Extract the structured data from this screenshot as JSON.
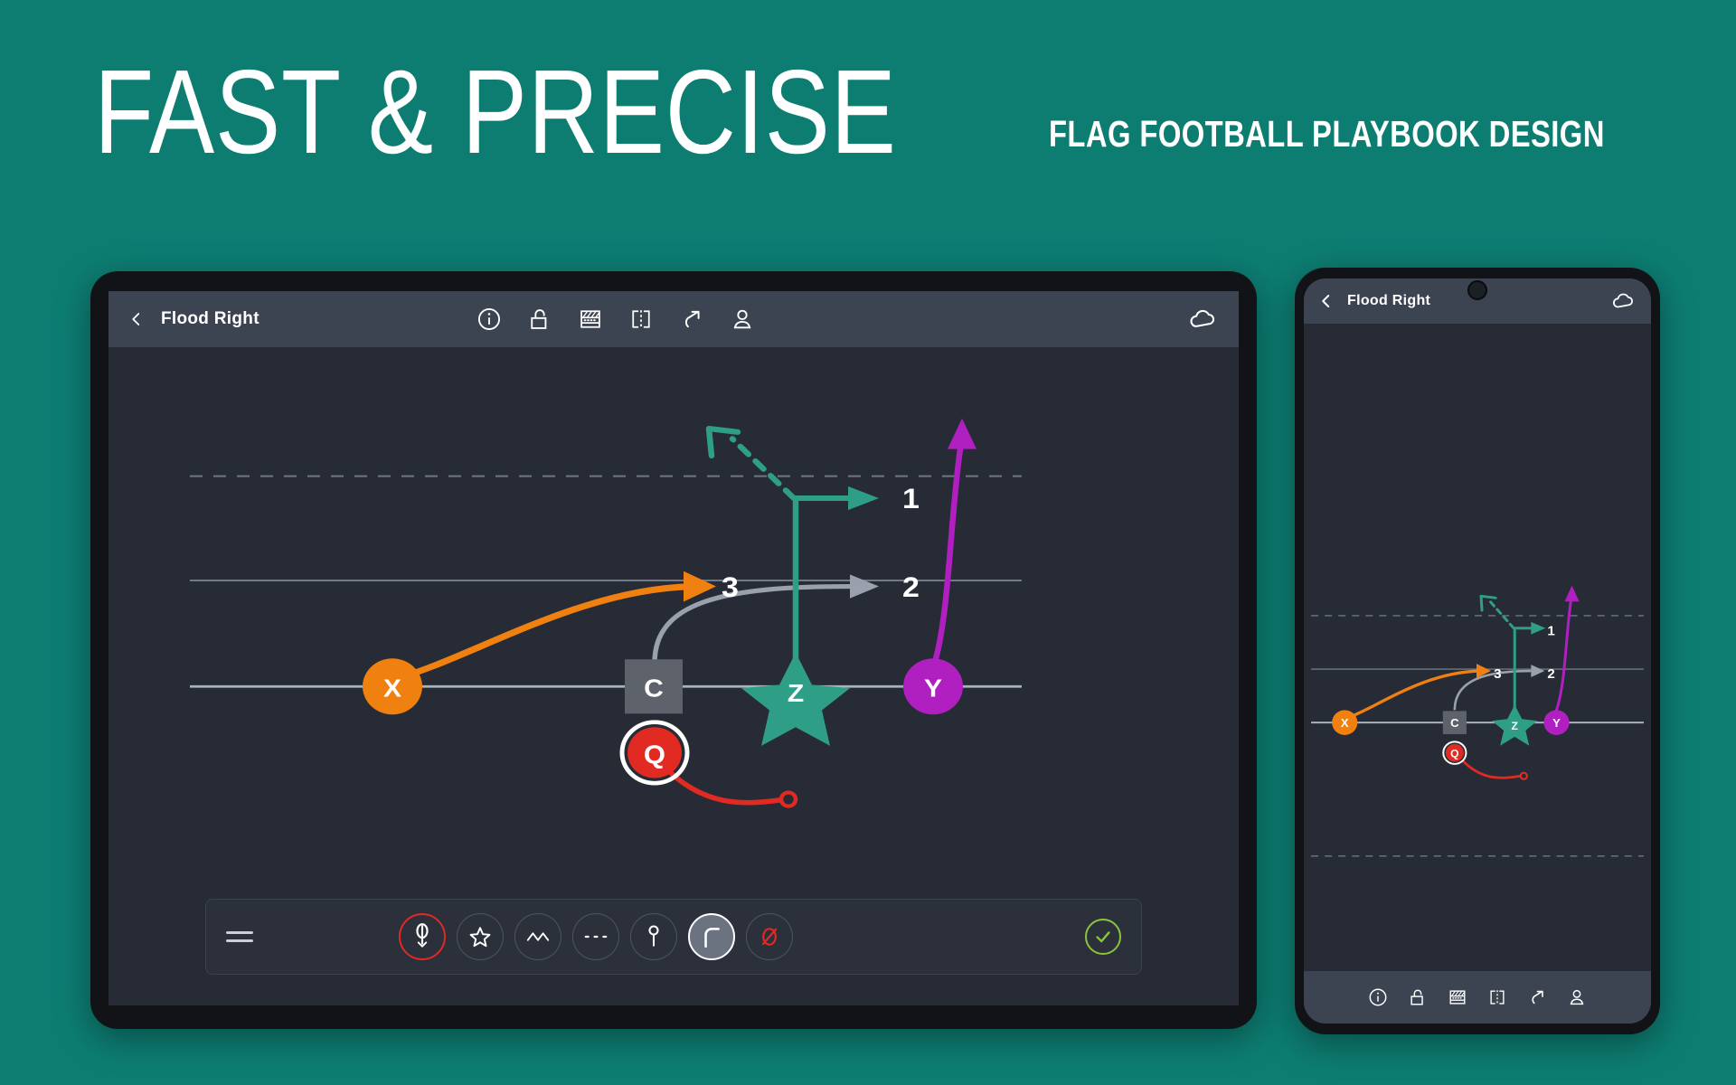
{
  "promo": {
    "headline": "FAST & PRECISE",
    "subhead": "FLAG FOOTBALL PLAYBOOK DESIGN",
    "background_color": "#0d7d72",
    "text_color": "#ffffff"
  },
  "app": {
    "title": "Flood Right",
    "header": {
      "back_label": "Back",
      "tools": [
        {
          "name": "info-icon",
          "label": "Info"
        },
        {
          "name": "unlock-icon",
          "label": "Unlock"
        },
        {
          "name": "field-icon",
          "label": "Field"
        },
        {
          "name": "mirror-icon",
          "label": "Mirror"
        },
        {
          "name": "resize-arrow-icon",
          "label": "Resize"
        },
        {
          "name": "player-icon",
          "label": "Player"
        }
      ],
      "cloud": {
        "name": "cloud-icon",
        "label": "Sync"
      }
    },
    "palette": {
      "menu_label": "Menu",
      "tools": [
        {
          "name": "route-q-icon",
          "label": "Quarterback route",
          "state": "accent-red"
        },
        {
          "name": "star-icon",
          "label": "Star",
          "state": "normal"
        },
        {
          "name": "zigzag-icon",
          "label": "Motion",
          "state": "normal"
        },
        {
          "name": "dashed-line-icon",
          "label": "Dashed route",
          "state": "normal"
        },
        {
          "name": "pin-icon",
          "label": "Pin",
          "state": "normal"
        },
        {
          "name": "curve-icon",
          "label": "Curve route",
          "state": "selected"
        },
        {
          "name": "block-icon",
          "label": "Block / none",
          "state": "accent-red-glyph"
        }
      ],
      "confirm": {
        "name": "confirm-check-icon",
        "label": "Done",
        "color": "#8ac43f"
      }
    }
  },
  "play": {
    "name": "Flood Right",
    "colors": {
      "orange": "#f08010",
      "gray": "#9aa0ac",
      "teal": "#2f9e87",
      "purple": "#b01fc0",
      "red": "#e02a22",
      "line": "#9aa4b4",
      "field_bg": "#262b35",
      "center_box": "#5e626a"
    },
    "players": [
      {
        "id": "X",
        "label": "X",
        "shape": "circle",
        "color": "#f08010",
        "route_label": "3"
      },
      {
        "id": "C",
        "label": "C",
        "shape": "square",
        "color": "#5e626a",
        "route_label": "2"
      },
      {
        "id": "Z",
        "label": "Z",
        "shape": "star",
        "color": "#2f9e87",
        "route_label": "1"
      },
      {
        "id": "Y",
        "label": "Y",
        "shape": "circle",
        "color": "#b01fc0",
        "route_label": ""
      },
      {
        "id": "Q",
        "label": "Q",
        "shape": "circle",
        "color": "#e02a22",
        "route_label": "",
        "selected": true
      }
    ],
    "route_labels": [
      "1",
      "2",
      "3"
    ]
  }
}
